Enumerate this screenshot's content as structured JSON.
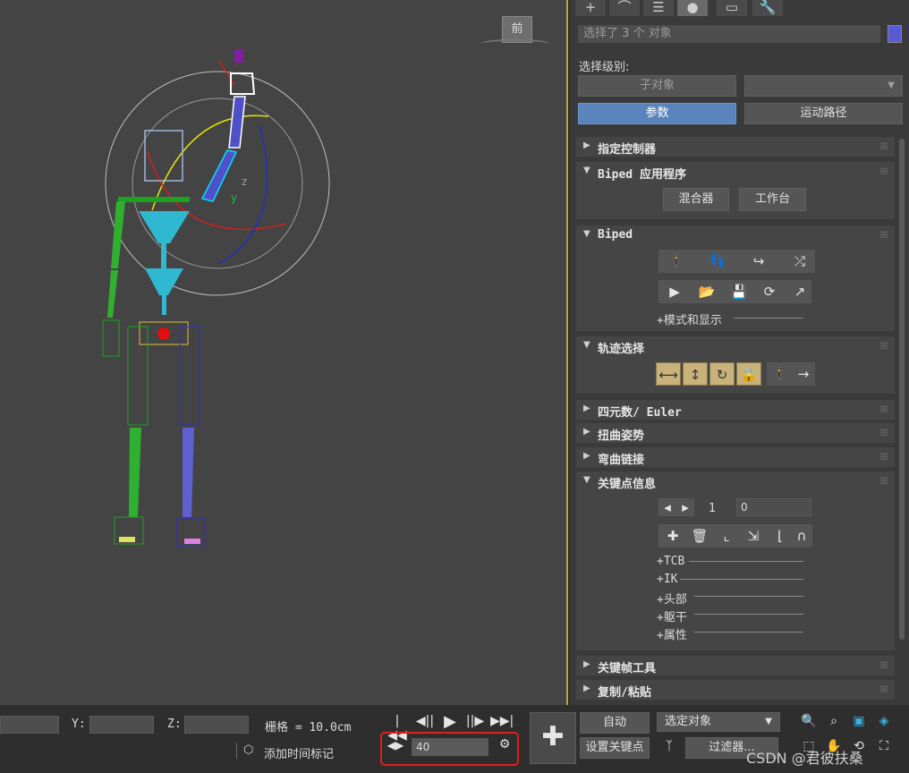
{
  "viewport": {
    "view_label": "前"
  },
  "tabs": [
    "+",
    "⌒",
    "☰",
    "●",
    "▭",
    "🔧"
  ],
  "panel": {
    "selection_text": "选择了 3 个 对象",
    "selection_level_label": "选择级别:",
    "sub_object_button": "子对象",
    "dropdown_arrow": "▼",
    "params_button": "参数",
    "motion_path_button": "运动路径"
  },
  "rollouts": {
    "assign_controller": "指定控制器",
    "biped_apps": "Biped 应用程序",
    "mixer_button": "混合器",
    "workbench_button": "工作台",
    "biped": "Biped",
    "mode_display": "+模式和显示",
    "track_selection": "轨迹选择",
    "quaternion": "四元数/ Euler",
    "twist_poses": "扭曲姿势",
    "bend_links": "弯曲链接",
    "key_info": "关键点信息",
    "key_index": "1",
    "key_time": "0",
    "tcb": "+TCB",
    "ik": "+IK",
    "head": "+头部",
    "body": "+躯干",
    "props": "+属性",
    "keyframe_tools": "关键帧工具",
    "copy_paste": "复制/粘贴"
  },
  "bottom": {
    "y_label": "Y:",
    "z_label": "Z:",
    "grid_label": "栅格 = 10.0cm",
    "add_time_tag": "添加时间标记",
    "frame_value": "40",
    "auto_button": "自动",
    "selected_objects": "选定对象",
    "set_key_button": "设置关键点",
    "filters_button": "过滤器...",
    "dropdown_arrow": "▼"
  },
  "watermark": "CSDN @君彼扶桑"
}
